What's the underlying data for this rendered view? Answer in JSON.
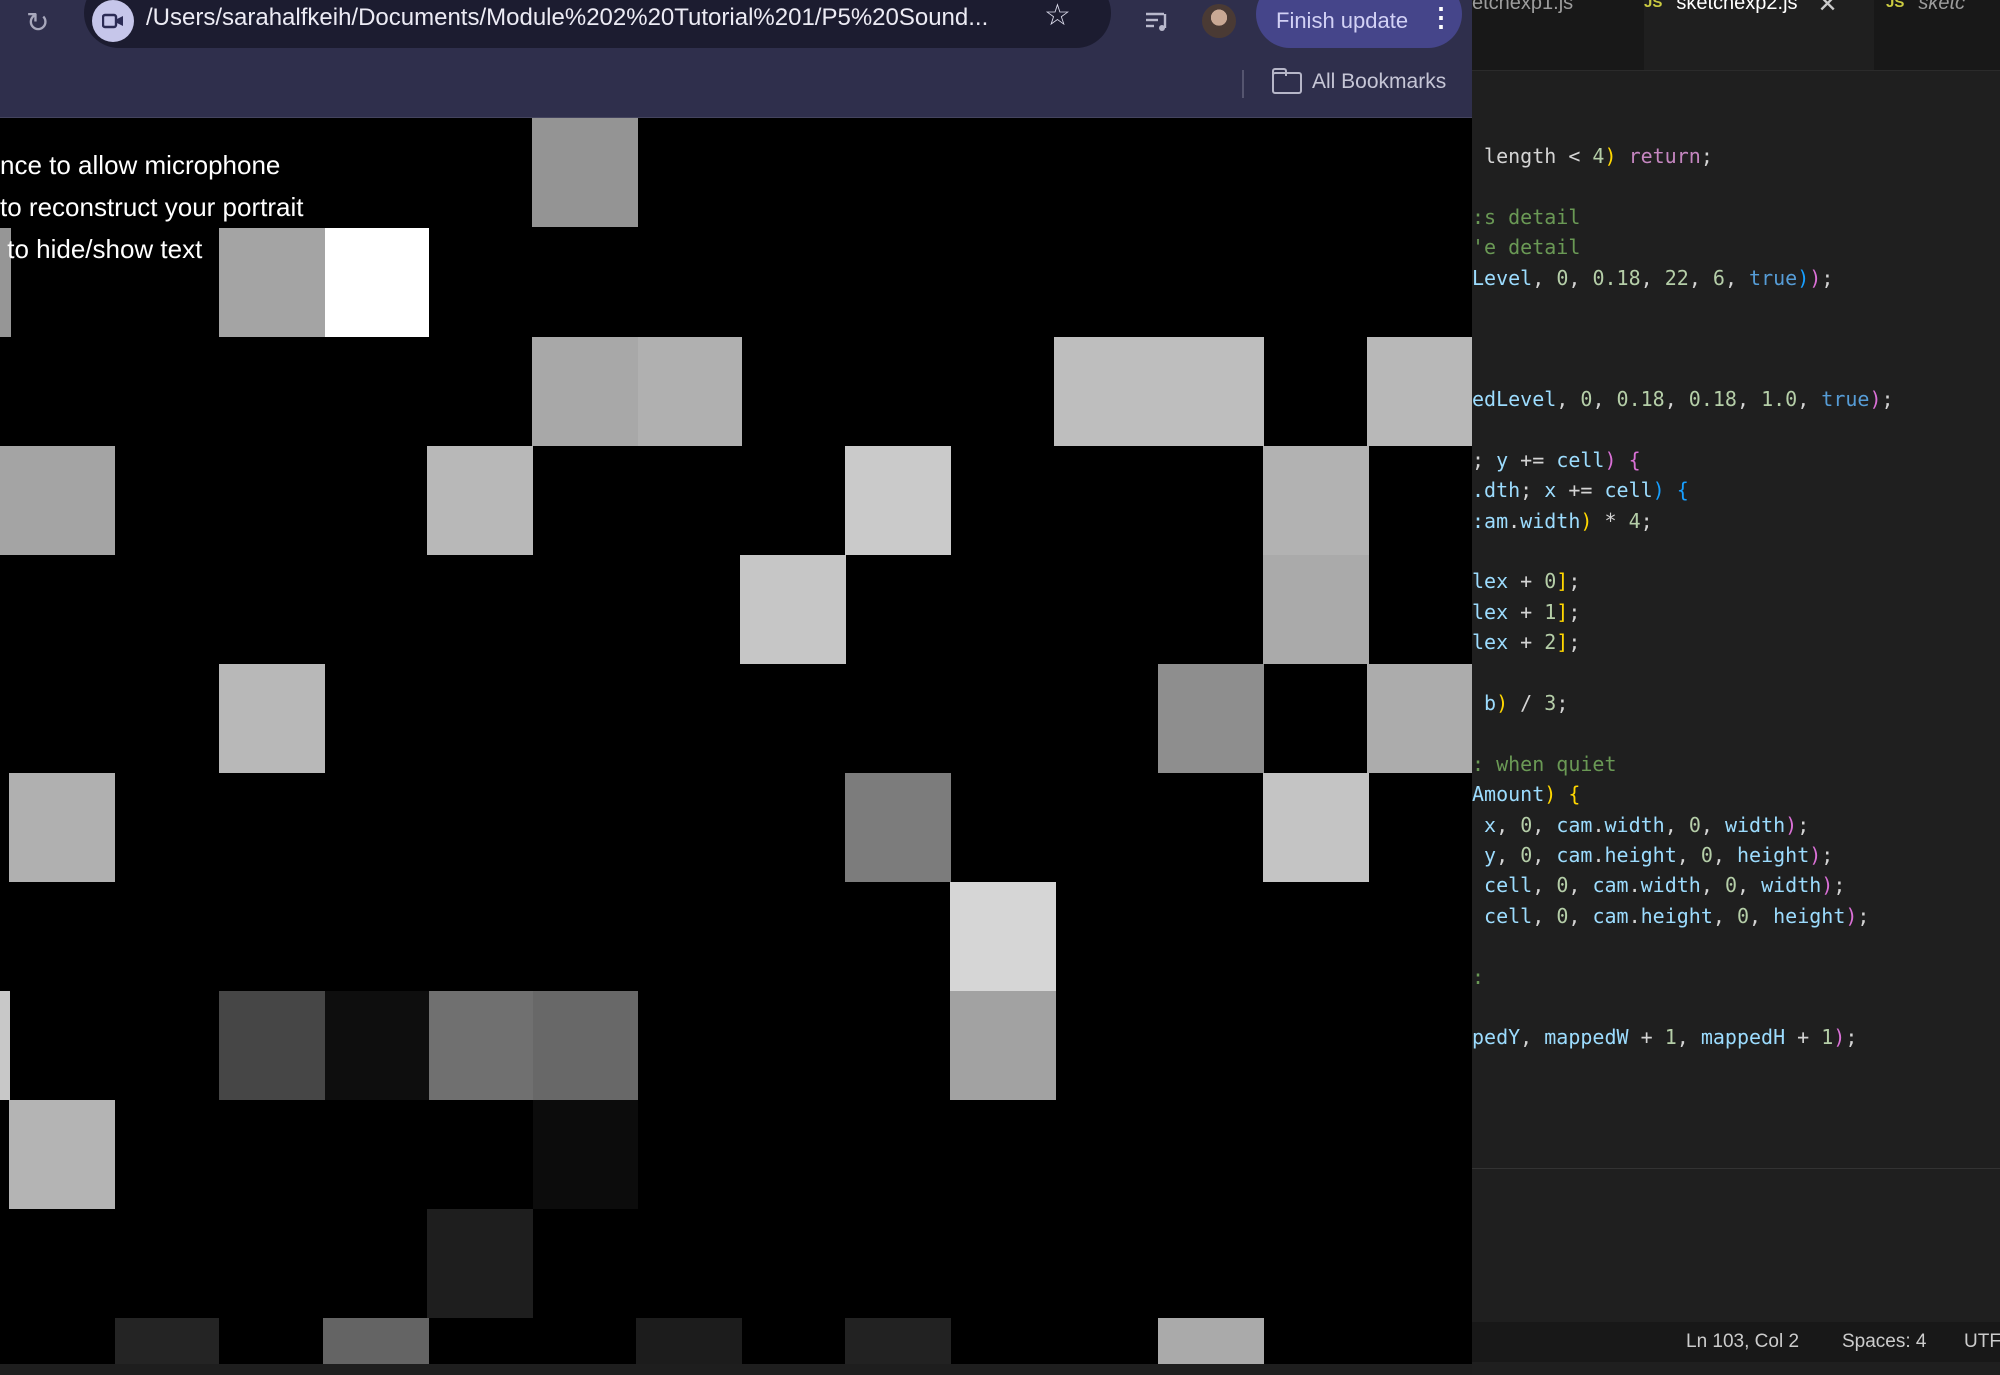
{
  "browser": {
    "url": "/Users/sarahalfkeih/Documents/Module%202%20Tutorial%201/P5%20Sound...",
    "update_button": "Finish update",
    "bookmarks_label": "All Bookmarks",
    "icons": [
      "reload-icon",
      "site-camera-icon",
      "star-icon",
      "tab-search-icon",
      "avatar",
      "kebab-menu-icon",
      "folder-icon"
    ]
  },
  "sketch": {
    "overlay_lines": [
      "nce to allow microphone",
      "to reconstruct your portrait",
      " to hide/show text"
    ]
  },
  "editor": {
    "tabs": [
      {
        "badge": "",
        "label": "etchexp1.js",
        "close": ""
      },
      {
        "badge": "JS",
        "label": "sketchexp2.js",
        "close": "✕"
      },
      {
        "badge": "JS",
        "label": "sketc",
        "close": ""
      }
    ],
    "status": {
      "position": "Ln 103, Col 2",
      "spaces": "Spaces: 4",
      "encoding": "UTF"
    }
  }
}
